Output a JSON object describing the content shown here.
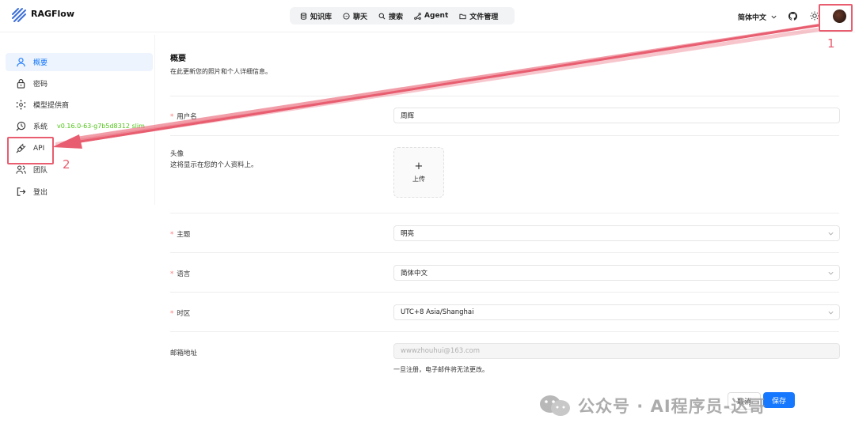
{
  "header": {
    "brand": "RAGFlow",
    "nav": [
      {
        "label": "知识库",
        "icon": "database-icon"
      },
      {
        "label": "聊天",
        "icon": "chat-icon"
      },
      {
        "label": "搜索",
        "icon": "search-icon"
      },
      {
        "label": "Agent",
        "icon": "agent-icon"
      },
      {
        "label": "文件管理",
        "icon": "folder-icon"
      }
    ],
    "language": "简体中文"
  },
  "sidebar": {
    "items": [
      {
        "label": "概要",
        "icon": "user-icon",
        "active": true
      },
      {
        "label": "密码",
        "icon": "lock-icon"
      },
      {
        "label": "模型提供商",
        "icon": "model-provider-icon"
      },
      {
        "label": "系统",
        "icon": "system-icon"
      },
      {
        "label": "API",
        "icon": "api-plug-icon"
      },
      {
        "label": "团队",
        "icon": "team-icon"
      },
      {
        "label": "登出",
        "icon": "logout-icon"
      }
    ],
    "version": "v0.16.0-63-g7b5d8312 slim"
  },
  "annotations": {
    "num1": "1",
    "num2": "2",
    "color": "#e85d6f"
  },
  "profile": {
    "title": "概要",
    "description": "在此更新您的照片和个人详细信息。",
    "username_label": "用户名",
    "username_value": "周辉",
    "avatar_label": "头像",
    "avatar_desc": "这将显示在您的个人资料上。",
    "upload_plus": "+",
    "upload_text": "上传",
    "theme_label": "主题",
    "theme_value": "明亮",
    "language_label": "语言",
    "language_value": "简体中文",
    "timezone_label": "时区",
    "timezone_value": "UTC+8 Asia/Shanghai",
    "email_label": "邮箱地址",
    "email_value": "wwwzhouhui@163.com",
    "email_note": "一旦注册，电子邮件将无法更改。",
    "cancel": "取消",
    "save": "保存"
  },
  "watermark": "公众号 · AI程序员-达哥",
  "colors": {
    "accent": "#1677ff",
    "active_bg": "#edf4fd",
    "version": "#52c41a",
    "required": "#ff7875"
  }
}
